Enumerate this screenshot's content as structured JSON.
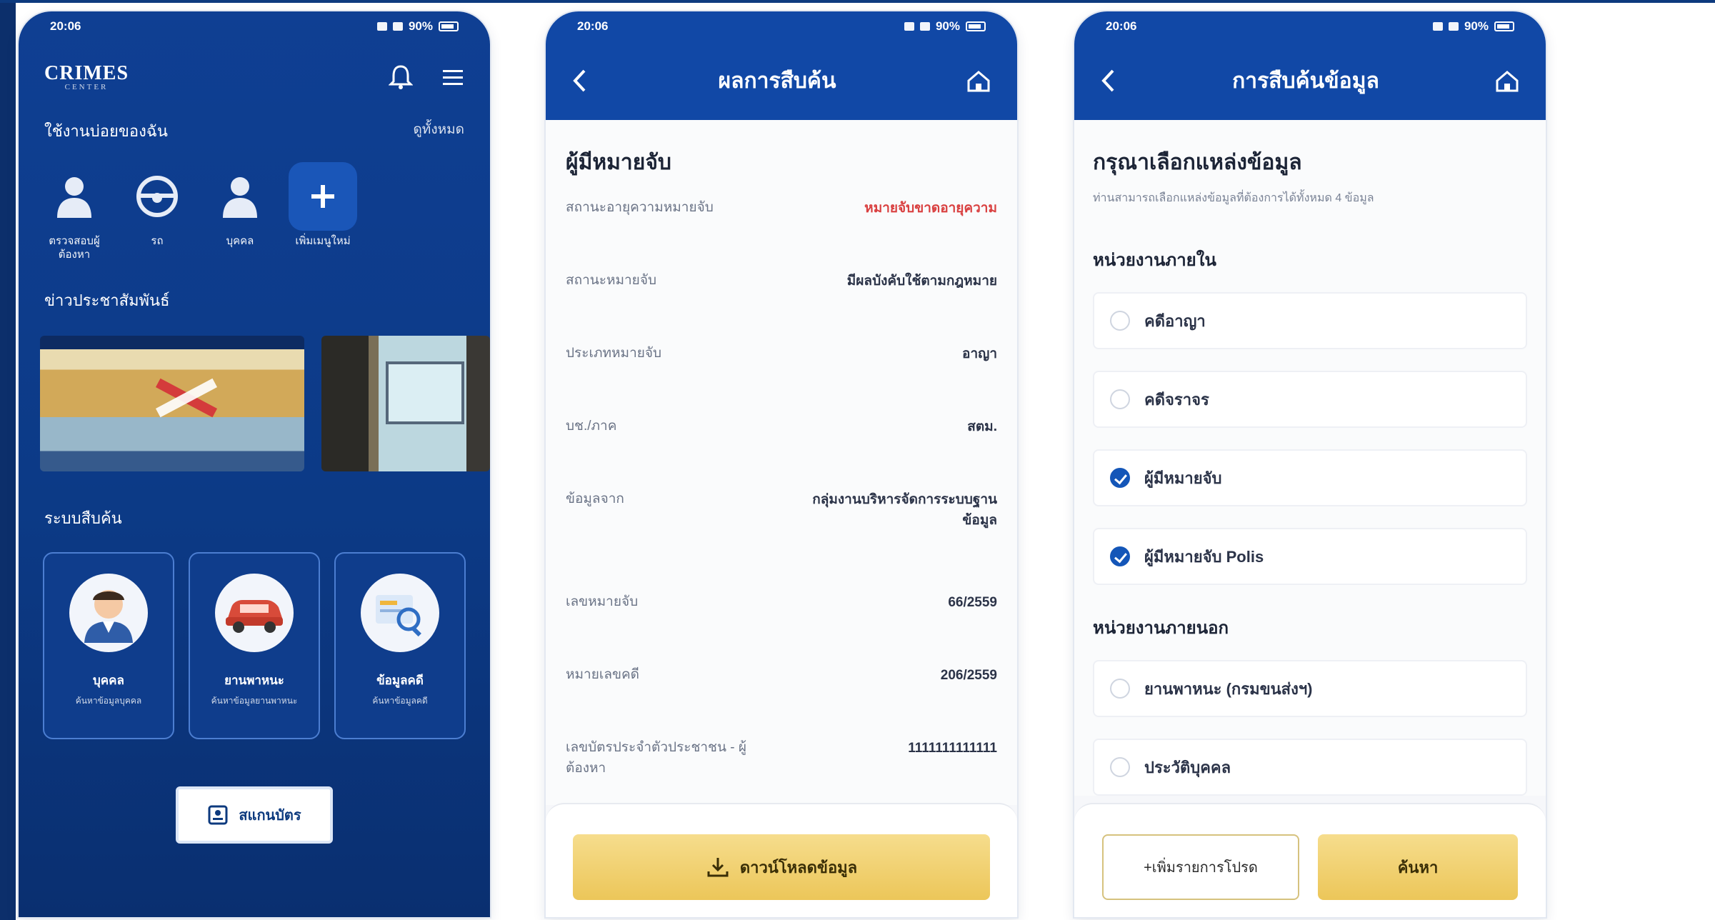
{
  "colors": {
    "frame": "#0d3a7e",
    "brand_blue": "#1148a6",
    "accent_gold": "#ecc659",
    "alert_red": "#d94040",
    "radio_checked": "#1456b8"
  },
  "phone1": {
    "status_time": "20:06",
    "status_right": "90%",
    "logo": "CRIMES",
    "logo_sub": "CENTER",
    "icons": [
      "bell-icon",
      "menu-icon"
    ],
    "quick_section_title": "ใช้งานบ่อยของฉัน",
    "quick_section_link": "ดูทั้งหมด",
    "quick_items": [
      {
        "label": "ตรวจสอบผู้ต้องหา",
        "icon": "person-icon"
      },
      {
        "label": "รถ",
        "icon": "steering-wheel-icon"
      },
      {
        "label": "บุคคล",
        "icon": "person-icon"
      },
      {
        "label": "เพิ่มเมนูใหม่",
        "icon": "plus-icon"
      }
    ],
    "news_title": "ข่าวประชาสัมพันธ์",
    "tools_title": "ระบบสืบค้น",
    "tools": [
      {
        "name": "บุคคล",
        "desc": "ค้นหาข้อมูลบุคคล",
        "icon": "officer-icon"
      },
      {
        "name": "ยานพาหนะ",
        "desc": "ค้นหาข้อมูลยานพาหนะ",
        "icon": "car-icon"
      },
      {
        "name": "ข้อมูลคดี",
        "desc": "ค้นหาข้อมูลคดี",
        "icon": "document-search-icon"
      }
    ],
    "scan_label": "สแกนบัตร"
  },
  "phone2": {
    "status_time": "20:06",
    "status_right": "90%",
    "title": "ผลการสืบค้น",
    "heading": "ผู้มีหมายจับ",
    "rows": [
      {
        "label": "สถานะอายุความหมายจับ",
        "value": "หมายจับขาดอายุความ",
        "style": "red"
      },
      {
        "label": "สถานะหมายจับ",
        "value": "มีผลบังคับใช้ตามกฎหมาย",
        "style": "normal"
      },
      {
        "label": "ประเภทหมายจับ",
        "value": "อาญา",
        "style": "normal"
      },
      {
        "label": "บช./ภาค",
        "value": "สตม.",
        "style": "normal"
      },
      {
        "label": "ข้อมูลจาก",
        "value": "กลุ่มงานบริหารจัดการระบบฐานข้อมูล",
        "style": "normal"
      },
      {
        "label": "เลขหมายจับ",
        "value": "66/2559",
        "style": "normal"
      },
      {
        "label": "หมายเลขคดี",
        "value": "206/2559",
        "style": "normal"
      },
      {
        "label": "เลขบัตรประจำตัวประชาชน - ผู้ต้องหา",
        "value": "1111111111111",
        "style": "normal"
      }
    ],
    "download_label": "ดาวน์โหลดข้อมูล"
  },
  "phone3": {
    "status_time": "20:06",
    "status_right": "90%",
    "title": "การสืบค้นข้อมูล",
    "heading": "กรุณาเลือกแหล่งข้อมูล",
    "subheading": "ท่านสามารถเลือกแหล่งข้อมูลที่ต้องการได้ทั้งหมด 4 ข้อมูล",
    "group_internal": "หน่วยงานภายใน",
    "group_external": "หน่วยงานภายนอก",
    "internal_options": [
      {
        "label": "คดีอาญา",
        "checked": false
      },
      {
        "label": "คดีจราจร",
        "checked": false
      },
      {
        "label": "ผู้มีหมายจับ",
        "checked": true
      },
      {
        "label": "ผู้มีหมายจับ Polis",
        "checked": true
      }
    ],
    "external_options": [
      {
        "label": "ยานพาหนะ (กรมขนส่งฯ)",
        "checked": false
      },
      {
        "label": "ประวัติบุคคล",
        "checked": false
      }
    ],
    "more_label": "+เพิ่มรายการโปรด",
    "search_label": "ค้นหา"
  }
}
